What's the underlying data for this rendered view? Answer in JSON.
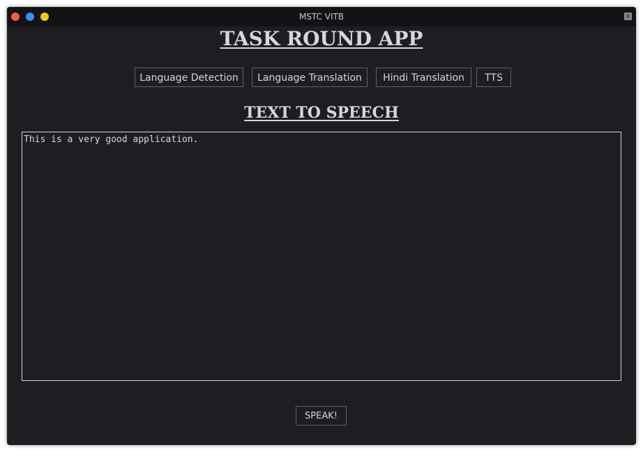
{
  "window": {
    "title": "MSTC VITB",
    "close_glyph": "x"
  },
  "app": {
    "title": "TASK ROUND APP"
  },
  "nav": {
    "items": [
      {
        "label": "Language Detection"
      },
      {
        "label": "Language Translation"
      },
      {
        "label": "Hindi Translation"
      },
      {
        "label": "TTS"
      }
    ]
  },
  "section": {
    "title": "TEXT TO SPEECH"
  },
  "input": {
    "value": "This is a very good application."
  },
  "actions": {
    "speak_label": "SPEAK!"
  },
  "colors": {
    "background": "#1e1e22",
    "titlebar": "#131316",
    "text": "#d6d6dc",
    "close_dot": "#f05c4e",
    "minimize_dot": "#3a8ff2",
    "maximize_dot": "#f5c518"
  }
}
